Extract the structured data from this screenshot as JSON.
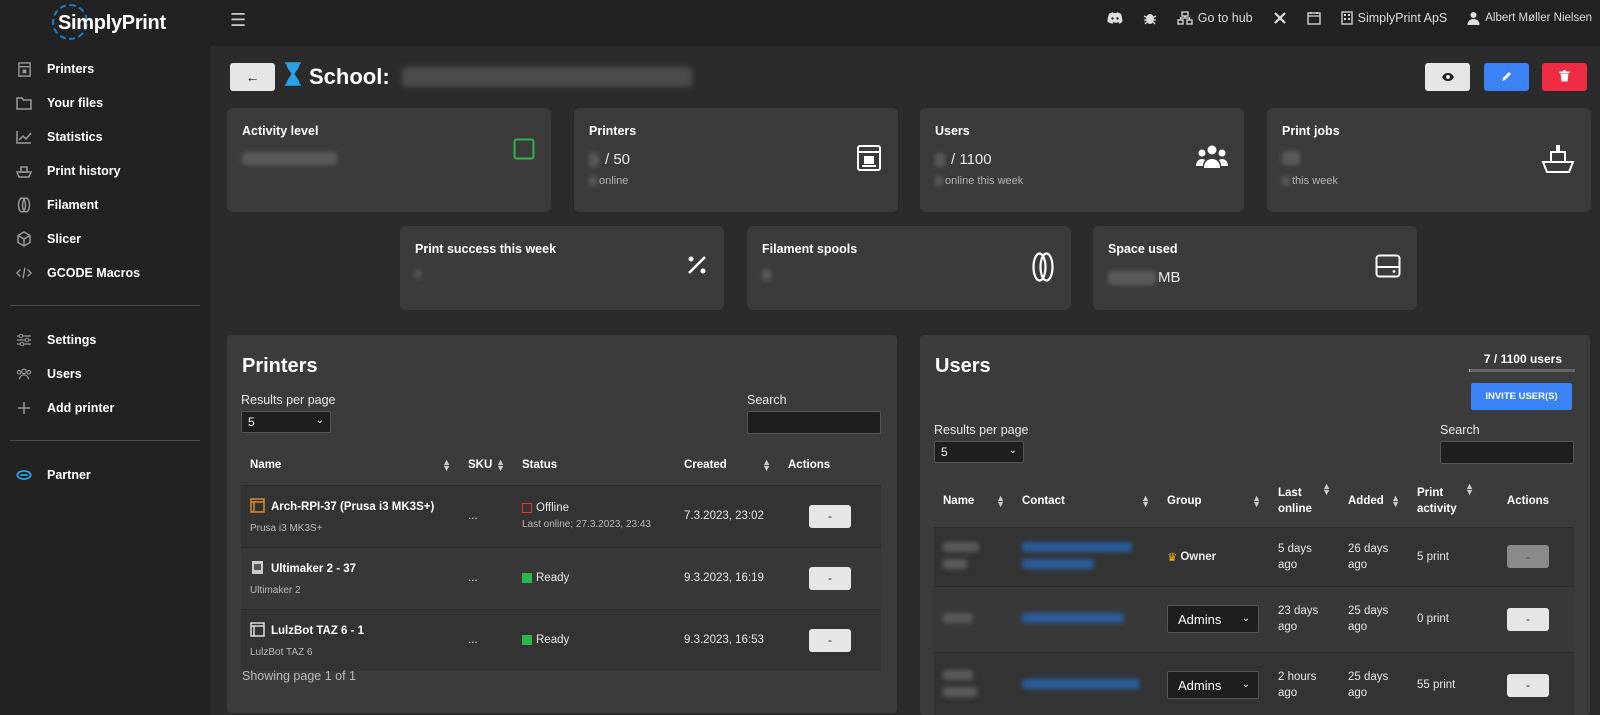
{
  "app": {
    "logo_text": "SimplyPrint"
  },
  "sidebar": {
    "items": [
      {
        "label": "Printers",
        "icon": "printer-icon"
      },
      {
        "label": "Your files",
        "icon": "folder-icon"
      },
      {
        "label": "Statistics",
        "icon": "chart-icon"
      },
      {
        "label": "Print history",
        "icon": "history-icon"
      },
      {
        "label": "Filament",
        "icon": "filament-icon"
      },
      {
        "label": "Slicer",
        "icon": "cube-icon"
      },
      {
        "label": "GCODE Macros",
        "icon": "code-icon"
      }
    ],
    "items2": [
      {
        "label": "Settings",
        "icon": "sliders-icon"
      },
      {
        "label": "Users",
        "icon": "users-icon"
      },
      {
        "label": "Add printer",
        "icon": "plus-icon"
      }
    ],
    "items3": [
      {
        "label": "Partner",
        "icon": "partner-icon"
      }
    ]
  },
  "topbar": {
    "hub_label": "Go to hub",
    "org_label": "SimplyPrint ApS",
    "user_label": "Albert Møller Nielsen"
  },
  "header": {
    "title": "School:",
    "accent": "#29a3e8"
  },
  "stats": {
    "activity": {
      "title": "Activity level"
    },
    "printers": {
      "title": "Printers",
      "value": "/ 50",
      "sub": "online"
    },
    "users": {
      "title": "Users",
      "value": "/ 1100",
      "sub": "online this week"
    },
    "jobs": {
      "title": "Print jobs",
      "sub": "this week"
    },
    "success": {
      "title": "Print success this week"
    },
    "spools": {
      "title": "Filament spools"
    },
    "space": {
      "title": "Space used",
      "value": "MB"
    }
  },
  "printers_panel": {
    "title": "Printers",
    "rpp_label": "Results per page",
    "rpp_value": "5",
    "search_label": "Search",
    "columns": [
      "Name",
      "SKU",
      "Status",
      "Created",
      "Actions"
    ],
    "rows": [
      {
        "name": "Arch-RPI-37 (Prusa i3 MK3S+)",
        "model": "Prusa i3 MK3S+",
        "sku": "...",
        "status": "Offline",
        "status_color": "#e53935",
        "last_online": "Last online; 27.3.2023, 23:43",
        "created": "7.3.2023, 23:02"
      },
      {
        "name": "Ultimaker 2 - 37",
        "model": "Ultimaker 2",
        "sku": "...",
        "status": "Ready",
        "status_color": "#2db54a",
        "last_online": "",
        "created": "9.3.2023, 16:19"
      },
      {
        "name": "LulzBot TAZ 6 - 1",
        "model": "LulzBot TAZ 6",
        "sku": "...",
        "status": "Ready",
        "status_color": "#2db54a",
        "last_online": "",
        "created": "9.3.2023, 16:53"
      }
    ],
    "action_label": "-",
    "pager": "Showing page 1 of 1"
  },
  "users_panel": {
    "title": "Users",
    "count_label": "7 / 1100 users",
    "count_progress": 0.0064,
    "invite_label": "INVITE USER(S)",
    "rpp_label": "Results per page",
    "rpp_value": "5",
    "search_label": "Search",
    "columns": {
      "name": "Name",
      "contact": "Contact",
      "group": "Group",
      "last_online_1": "Last",
      "last_online_2": "online",
      "added": "Added",
      "activity_1": "Print",
      "activity_2": "activity",
      "actions": "Actions"
    },
    "rows": [
      {
        "group": "Owner",
        "group_type": "badge",
        "last_online_1": "5 days",
        "last_online_2": "ago",
        "added_1": "26 days",
        "added_2": "ago",
        "activity": "5 print"
      },
      {
        "group": "Admins",
        "group_type": "select",
        "last_online_1": "23 days",
        "last_online_2": "ago",
        "added_1": "25 days",
        "added_2": "ago",
        "activity": "0 print"
      },
      {
        "group": "Admins",
        "group_type": "select",
        "last_online_1": "2 hours",
        "last_online_2": "ago",
        "added_1": "25 days",
        "added_2": "ago",
        "activity": "55 print"
      }
    ],
    "action_label": "-"
  }
}
